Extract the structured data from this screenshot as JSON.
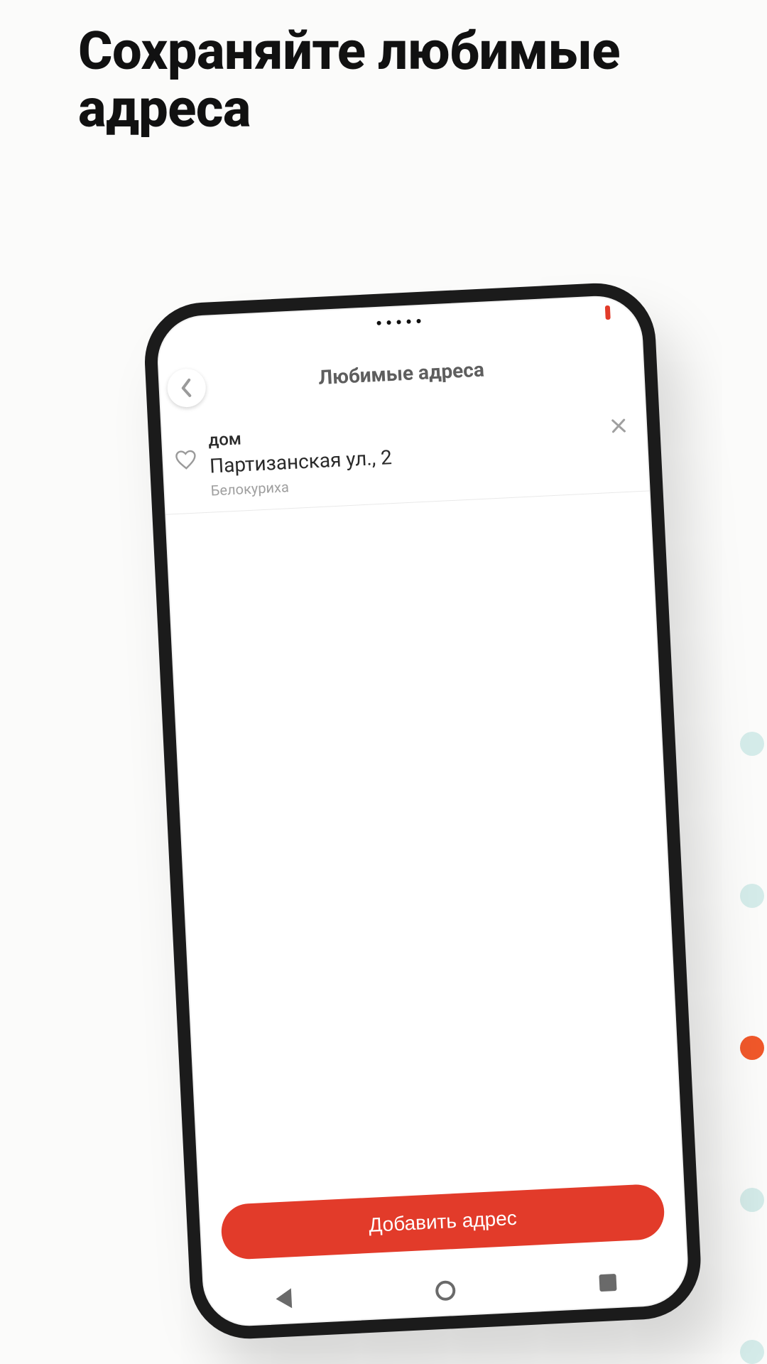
{
  "marketing": {
    "headline": "Сохраняйте любимые адреса"
  },
  "screen": {
    "title": "Любимые адреса",
    "add_button": "Добавить адрес"
  },
  "addresses": [
    {
      "label": "дом",
      "street": "Партизанская ул., 2",
      "city": "Белокуриха"
    }
  ],
  "pagination": {
    "total": 5,
    "active_index": 2
  },
  "colors": {
    "accent": "#e23b2a",
    "dot_inactive": "#d4ebe9",
    "dot_active": "#f0582a"
  }
}
